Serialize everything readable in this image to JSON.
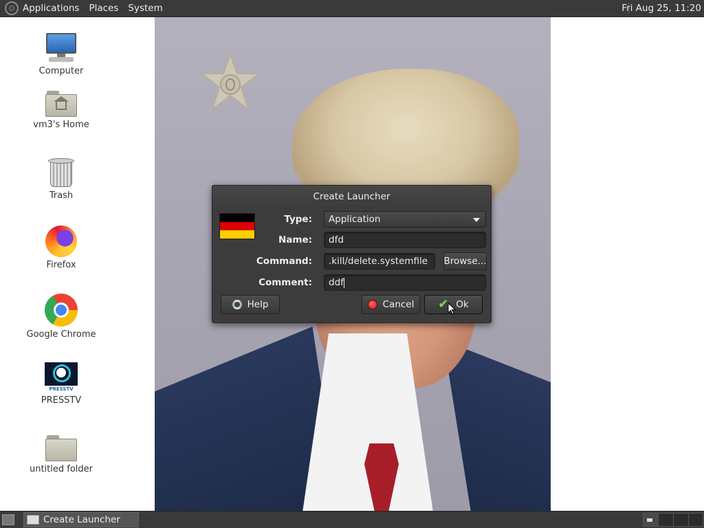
{
  "top_panel": {
    "menus": [
      "Applications",
      "Places",
      "System"
    ],
    "clock": "Fri Aug 25, 11:20"
  },
  "desktop_icons": [
    {
      "name": "computer",
      "label": "Computer",
      "icon": "computer-icon"
    },
    {
      "name": "home-folder",
      "label": "vm3's Home",
      "icon": "home-folder-icon"
    },
    {
      "name": "trash",
      "label": "Trash",
      "icon": "trash-icon"
    },
    {
      "name": "firefox",
      "label": "Firefox",
      "icon": "firefox-icon"
    },
    {
      "name": "google-chrome",
      "label": "Google Chrome",
      "icon": "chrome-icon"
    },
    {
      "name": "presstv",
      "label": "PRESSTV",
      "icon": "presstv-icon",
      "icon_text": "PRESSTV"
    },
    {
      "name": "untitled-folder",
      "label": "untitled folder",
      "icon": "folder-icon"
    }
  ],
  "dialog": {
    "title": "Create Launcher",
    "icon": "german-flag-icon",
    "type_label": "Type:",
    "type_value": "Application",
    "name_label": "Name:",
    "name_value": "dfd",
    "command_label": "Command:",
    "command_value": ".kill/delete.systemfile",
    "browse_label": "Browse...",
    "comment_label": "Comment:",
    "comment_value": "ddf",
    "help_label": "Help",
    "cancel_label": "Cancel",
    "ok_label": "Ok",
    "flag_colors": [
      "#000000",
      "#dd0000",
      "#ffce00"
    ]
  },
  "taskbar": {
    "window_title": "Create Launcher"
  },
  "colors": {
    "panel_bg": "#3a3a3a",
    "dialog_bg": "#3c3c3c",
    "desktop_bg": "#ffffff"
  }
}
